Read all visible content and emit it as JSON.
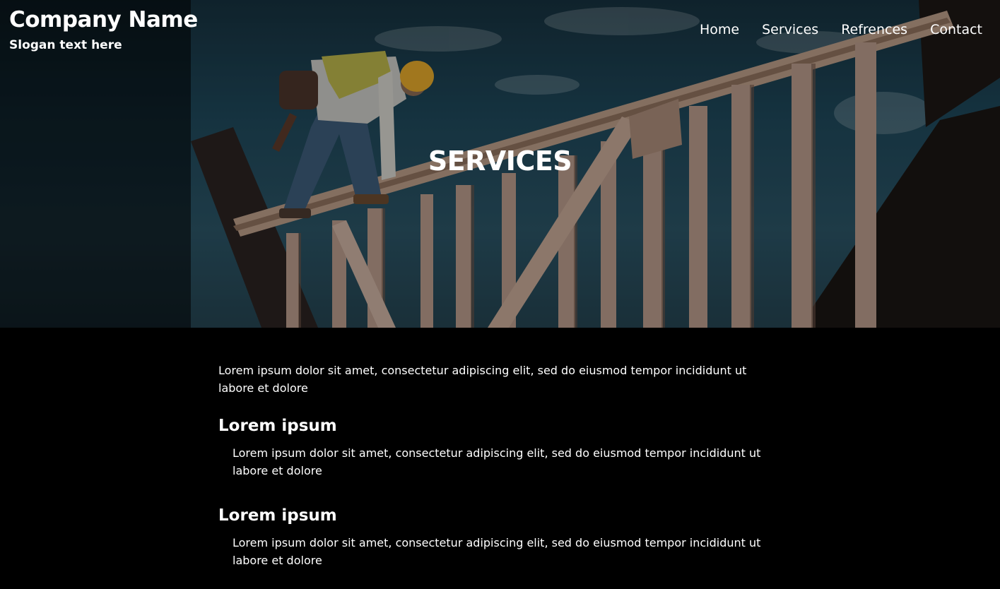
{
  "header": {
    "company_name": "Company Name",
    "slogan": "Slogan text here"
  },
  "nav": {
    "items": [
      {
        "label": "Home"
      },
      {
        "label": "Services"
      },
      {
        "label": "Refrences"
      },
      {
        "label": "Contact"
      }
    ]
  },
  "hero": {
    "title": "SERVICES",
    "image": "construction worker on wooden house frame"
  },
  "main": {
    "intro": "Lorem ipsum dolor sit amet, consectetur adipiscing elit, sed do eiusmod tempor incididunt ut labore et dolore",
    "sections": [
      {
        "heading": "Lorem ipsum",
        "text": "Lorem ipsum dolor sit amet, consectetur adipiscing elit, sed do eiusmod tempor incididunt ut labore et dolore"
      },
      {
        "heading": "Lorem ipsum",
        "text": "Lorem ipsum dolor sit amet, consectetur adipiscing elit, sed do eiusmod tempor incididunt ut labore et dolore"
      }
    ]
  },
  "colors": {
    "background": "#000000",
    "text": "#ffffff"
  }
}
